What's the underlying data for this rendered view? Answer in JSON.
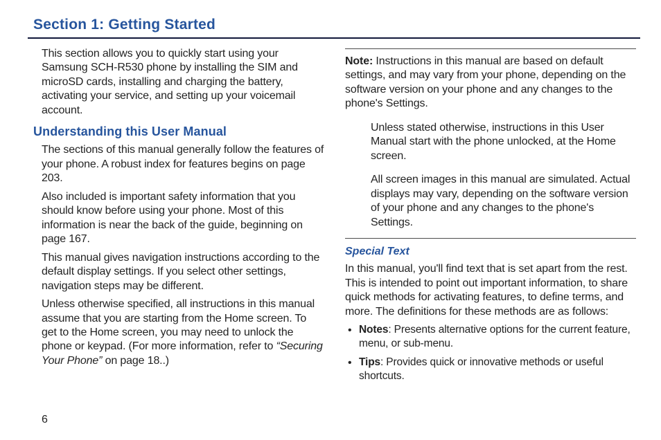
{
  "section_title": "Section 1: Getting Started",
  "page_number": "6",
  "left": {
    "intro": "This section allows you to quickly start using your Samsung SCH-R530 phone by installing the SIM and microSD cards, installing and charging the battery, activating your service, and setting up your voicemail account.",
    "h2": "Understanding this User Manual",
    "p1": "The sections of this manual generally follow the features of your phone. A robust index for features begins on page 203.",
    "p2": "Also included is important safety information that you should know before using your phone. Most of this information is near the back of the guide, beginning on page 167.",
    "p3": "This manual gives navigation instructions according to the default display settings. If you select other settings, navigation steps may be different.",
    "p4_a": "Unless otherwise specified, all instructions in this manual assume that you are starting from the Home screen. To get to the Home screen, you may need to unlock the phone or keypad. (For more information, refer to ",
    "p4_italic": "“Securing Your Phone”",
    "p4_b": "  on page 18..)"
  },
  "right": {
    "note_label": "Note:",
    "note1_rest": " Instructions in this manual are based on default settings, and may vary from your phone, depending on the software version on your phone and any changes to the phone's Settings.",
    "note2": "Unless stated otherwise, instructions in this User Manual start with the phone unlocked, at the Home screen.",
    "note3": "All screen images in this manual are simulated. Actual displays may vary, depending on the software version of your phone and any changes to the phone's Settings.",
    "h3": "Special Text",
    "sp_intro": "In this manual, you'll find text that is set apart from the rest. This is intended to point out important information, to share quick methods for activating features, to define terms, and more. The definitions for these methods are as follows:",
    "bullets": [
      {
        "term": "Notes",
        "desc": ": Presents alternative options for the current feature, menu, or sub-menu."
      },
      {
        "term": "Tips",
        "desc": ": Provides quick or innovative methods or useful shortcuts."
      }
    ]
  }
}
